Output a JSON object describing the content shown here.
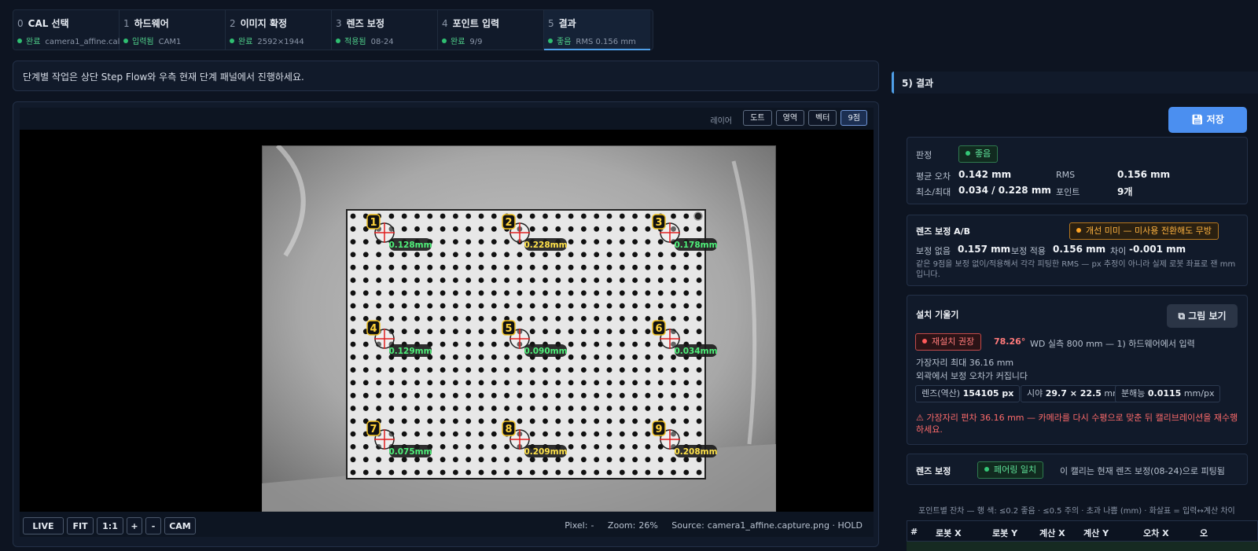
{
  "steps": [
    {
      "num": "0",
      "title": "CAL 선택",
      "status": "완료",
      "detail": "camera1_affine.cal"
    },
    {
      "num": "1",
      "title": "하드웨어",
      "status": "입력됨",
      "detail": "CAM1"
    },
    {
      "num": "2",
      "title": "이미지 확정",
      "status": "완료",
      "detail": "2592×1944"
    },
    {
      "num": "3",
      "title": "렌즈 보정",
      "status": "적용됨",
      "detail": "08-24"
    },
    {
      "num": "4",
      "title": "포인트 입력",
      "status": "완료",
      "detail": "9/9"
    },
    {
      "num": "5",
      "title": "결과",
      "status": "좋음",
      "detail": "RMS 0.156 mm"
    }
  ],
  "hint": "단계별 작업은 상단 Step Flow와 우측 현재 단계 패널에서 진행하세요.",
  "layers": {
    "label": "레이어",
    "buttons": [
      "도트",
      "영역",
      "벡터",
      "9점"
    ],
    "active": "9점"
  },
  "points": [
    {
      "id": "1",
      "err": "0.128mm",
      "color": "#4ff07a"
    },
    {
      "id": "2",
      "err": "0.228mm",
      "color": "#ffe24a"
    },
    {
      "id": "3",
      "err": "0.178mm",
      "color": "#4ff07a"
    },
    {
      "id": "4",
      "err": "0.129mm",
      "color": "#4ff07a"
    },
    {
      "id": "5",
      "err": "0.090mm",
      "color": "#4ff07a"
    },
    {
      "id": "6",
      "err": "0.034mm",
      "color": "#4ff07a"
    },
    {
      "id": "7",
      "err": "0.075mm",
      "color": "#4ff07a"
    },
    {
      "id": "8",
      "err": "0.209mm",
      "color": "#ffe24a"
    },
    {
      "id": "9",
      "err": "0.208mm",
      "color": "#ffe24a"
    }
  ],
  "controls": {
    "live": "LIVE",
    "fit": "FIT",
    "one": "1:1",
    "plus": "+",
    "minus": "-",
    "cam": "CAM",
    "pixel_label": "Pixel:",
    "pixel_value": "-",
    "zoom_label": "Zoom:",
    "zoom_value": "26%",
    "source_label": "Source:",
    "source_value": "camera1_affine.capture.png · HOLD"
  },
  "panel": {
    "title": "5) 결과",
    "save": "저장",
    "summary": {
      "verdict_label": "판정",
      "verdict": "좋음",
      "mean_label": "평균 오차",
      "mean": "0.142 mm",
      "rms_label": "RMS",
      "rms": "0.156 mm",
      "minmax_label": "최소/최대",
      "minmax": "0.034 / 0.228 mm",
      "points_label": "포인트",
      "points": "9개"
    },
    "lens_ab": {
      "title": "렌즈 보정 A/B",
      "badge": "개선 미미 — 미사용 전환해도 무방",
      "off_label": "보정 없음",
      "off": "0.157 mm",
      "on_label": "보정 적용",
      "on": "0.156 mm",
      "diff_label": "차이",
      "diff": "-0.001 mm",
      "note": "같은 9점을 보정 없이/적용해서 각각 피팅한 RMS — px 추정이 아니라 실제 로봇 좌표로 잰 mm 입니다."
    },
    "tilt": {
      "title": "설치 기울기",
      "view_button": "그림 보기",
      "badge": "재설치 권장",
      "angle": "78.26°",
      "wd_note": "WD 실측 800 mm — 1) 하드웨어에서 입력",
      "edge_max": "가장자리 최대 36.16 mm",
      "edge_note": "외곽에서 보정 오차가 커집니다",
      "chip1_label": "렌즈(역산)",
      "chip1_value": "154105 px",
      "chip2_label": "시야",
      "chip2_value": "29.7 × 22.5",
      "chip2_unit": "mm",
      "chip3_label": "분해능",
      "chip3_value": "0.0115",
      "chip3_unit": "mm/px",
      "warning": "가장자리 편차 36.16 mm — 카메라를 다시 수평으로 맞춘 뒤 캘리브레이션을 재수행하세요."
    },
    "lens": {
      "label": "렌즈 보정",
      "badge": "페어링 일치",
      "note": "이 캘리는 현재 렌즈 보정(08-24)으로 피팅됨"
    },
    "residual_note": "포인트별 잔차 — 행 색: ≤0.2 좋음 · ≤0.5 주의 · 초과 나쁨 (mm) · 화살표 = 입력↔계산 차이",
    "table_headers": [
      "#",
      "로봇 X",
      "로봇 Y",
      "계산 X",
      "계산 Y",
      "오차 X",
      "오"
    ]
  },
  "colors": {
    "accent": "#4f9fe8",
    "good": "#34c777",
    "warn": "#ffa424",
    "bad": "#ff5a5a"
  }
}
